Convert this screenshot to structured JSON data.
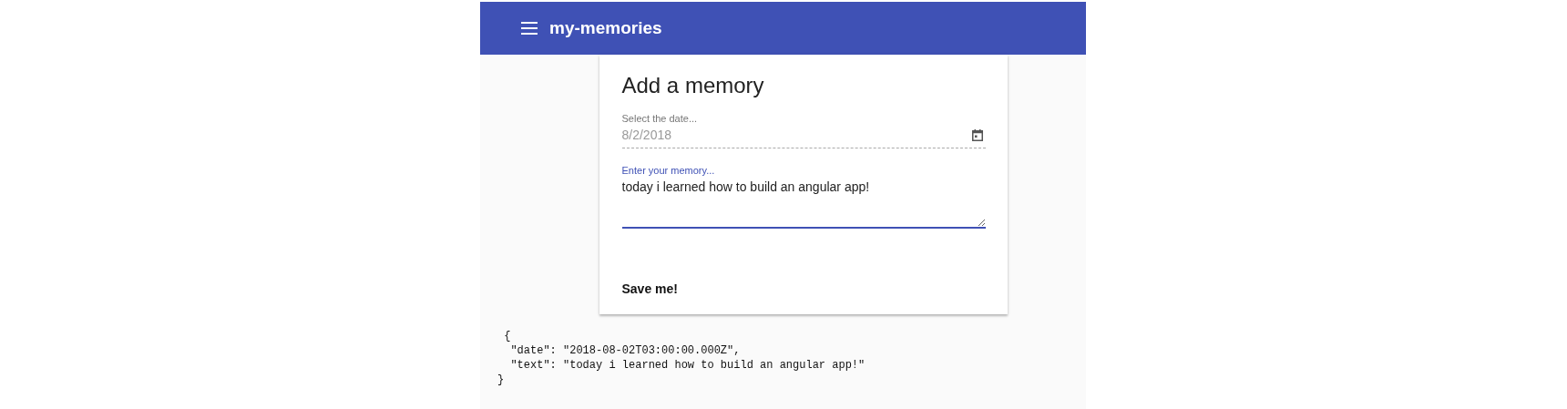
{
  "toolbar": {
    "title": "my-memories"
  },
  "card": {
    "title": "Add a memory",
    "date_field": {
      "label": "Select the date...",
      "value": "8/2/2018",
      "disabled": true
    },
    "memory_field": {
      "label": "Enter your memory...",
      "value": "today i learned how to build an angular app!",
      "focused": true
    },
    "button": "Save me!"
  },
  "output_lines": [
    " {",
    "  \"date\": \"2018-08-02T03:00:00.000Z\",",
    "  \"text\": \"today i learned how to build an angular app!\"",
    "}"
  ]
}
